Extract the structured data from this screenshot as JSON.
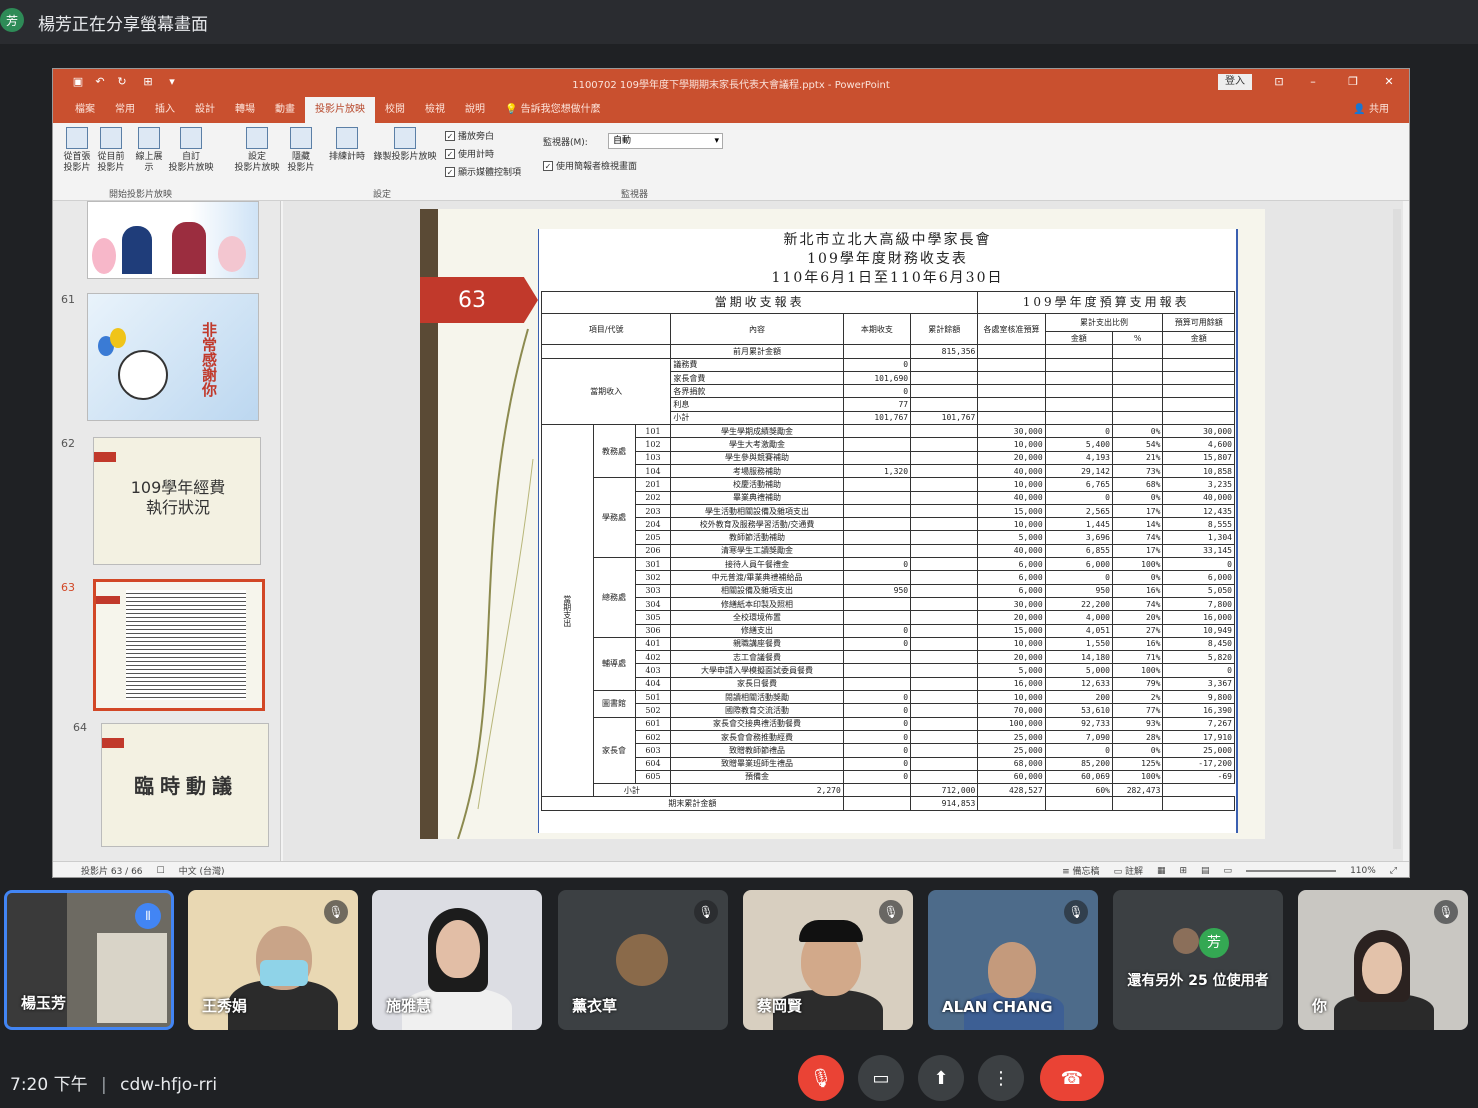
{
  "share_bar": {
    "avatar_initial": "芳",
    "text": "楊芳正在分享螢幕畫面"
  },
  "ppt": {
    "window_title": "1100702 109學年度下學期期末家長代表大會議程.pptx - PowerPoint",
    "login_label": "登入",
    "share_label": "共用",
    "tabs": [
      "檔案",
      "常用",
      "插入",
      "設計",
      "轉場",
      "動畫",
      "投影片放映",
      "校閱",
      "檢視",
      "說明"
    ],
    "tell_me": "告訴我您想做什麼",
    "ribbon_buttons": [
      {
        "label": "從首張\n投影片"
      },
      {
        "label": "從目前\n投影片"
      },
      {
        "label": "線上展\n示"
      },
      {
        "label": "自訂\n投影片放映"
      },
      {
        "label": "設定\n投影片放映"
      },
      {
        "label": "隱藏\n投影片"
      },
      {
        "label": "排練計時"
      },
      {
        "label": "錄製投影片放映"
      }
    ],
    "checkboxes": [
      "播放旁白",
      "使用計時",
      "顯示媒體控制項",
      "使用簡報者檢視畫面"
    ],
    "monitor_label": "監視器(M):",
    "monitor_value": "自動",
    "groups": [
      "開始投影片放映",
      "設定",
      "監視器"
    ],
    "status": {
      "slide_counter": "投影片 63 / 66",
      "language": "中文 (台灣)",
      "notes": "備忘稿",
      "comments": "註解",
      "zoom": "110%"
    }
  },
  "thumbnails": [
    {
      "num": "",
      "kind": "people"
    },
    {
      "num": "61",
      "kind": "thanks",
      "text": "非常感謝你"
    },
    {
      "num": "62",
      "kind": "title",
      "text": "109學年經費\n執行狀況"
    },
    {
      "num": "63",
      "kind": "table"
    },
    {
      "num": "64",
      "kind": "title2",
      "text": "臨時動議"
    }
  ],
  "slide": {
    "number": "63",
    "report_title_1": "新北市立北大高級中學家長會",
    "report_title_2": "109學年度財務收支表",
    "report_title_3": "110年6月1日至110年6月30日",
    "section_left": "當期收支報表",
    "section_right": "109學年度預算支用報表",
    "headers": {
      "item": "項目/代號",
      "content": "內容",
      "current": "本期收支",
      "cum_balance": "累計餘額",
      "approved": "各處室核准預算",
      "cum_ratio": "累計支出比例",
      "amount": "金額",
      "pct": "%",
      "remain": "預算可用餘額",
      "remain_amt": "金額"
    },
    "prev_balance_label": "前月累計金額",
    "prev_balance": "815,356",
    "income_group": "當期收入",
    "income_rows": [
      {
        "content": "議務費",
        "current": "0",
        "cum": ""
      },
      {
        "content": "家長會費",
        "current": "101,690",
        "cum": ""
      },
      {
        "content": "各界捐款",
        "current": "0",
        "cum": ""
      },
      {
        "content": "利息",
        "current": "77",
        "cum": ""
      },
      {
        "content": "小計",
        "current": "101,767",
        "cum": "101,767"
      }
    ],
    "expense_group": "當期支出",
    "expense_depts": [
      {
        "name": "教務處",
        "rows": [
          {
            "code": "101",
            "content": "學生學期成績獎勵金",
            "current": "",
            "budget": "30,000",
            "amt": "0",
            "pct": "0%",
            "remain": "30,000"
          },
          {
            "code": "102",
            "content": "學生大考激勵金",
            "current": "",
            "budget": "10,000",
            "amt": "5,400",
            "pct": "54%",
            "remain": "4,600"
          },
          {
            "code": "103",
            "content": "學生參與競賽補助",
            "current": "",
            "budget": "20,000",
            "amt": "4,193",
            "pct": "21%",
            "remain": "15,807"
          },
          {
            "code": "104",
            "content": "考場服務補助",
            "current": "1,320",
            "budget": "40,000",
            "amt": "29,142",
            "pct": "73%",
            "remain": "10,858"
          }
        ]
      },
      {
        "name": "學務處",
        "rows": [
          {
            "code": "201",
            "content": "校慶活動補助",
            "current": "",
            "budget": "10,000",
            "amt": "6,765",
            "pct": "68%",
            "remain": "3,235"
          },
          {
            "code": "202",
            "content": "畢業典禮補助",
            "current": "",
            "budget": "40,000",
            "amt": "0",
            "pct": "0%",
            "remain": "40,000"
          },
          {
            "code": "203",
            "content": "學生活動相關設備及雜項支出",
            "current": "",
            "budget": "15,000",
            "amt": "2,565",
            "pct": "17%",
            "remain": "12,435"
          },
          {
            "code": "204",
            "content": "校外教育及服務學習活動/交通費",
            "current": "",
            "budget": "10,000",
            "amt": "1,445",
            "pct": "14%",
            "remain": "8,555"
          },
          {
            "code": "205",
            "content": "教師節活動補助",
            "current": "",
            "budget": "5,000",
            "amt": "3,696",
            "pct": "74%",
            "remain": "1,304"
          },
          {
            "code": "206",
            "content": "清寒學生工讀獎勵金",
            "current": "",
            "budget": "40,000",
            "amt": "6,855",
            "pct": "17%",
            "remain": "33,145"
          }
        ]
      },
      {
        "name": "總務處",
        "rows": [
          {
            "code": "301",
            "content": "接待人員午餐禮金",
            "current": "0",
            "budget": "6,000",
            "amt": "6,000",
            "pct": "100%",
            "remain": "0"
          },
          {
            "code": "302",
            "content": "中元普渡/畢業典禮補給品",
            "current": "",
            "budget": "6,000",
            "amt": "0",
            "pct": "0%",
            "remain": "6,000"
          },
          {
            "code": "303",
            "content": "相關設備及雜項支出",
            "current": "950",
            "budget": "6,000",
            "amt": "950",
            "pct": "16%",
            "remain": "5,050"
          },
          {
            "code": "304",
            "content": "修繕紙本印製及照相",
            "current": "",
            "budget": "30,000",
            "amt": "22,200",
            "pct": "74%",
            "remain": "7,800"
          },
          {
            "code": "305",
            "content": "全校環境佈置",
            "current": "",
            "budget": "20,000",
            "amt": "4,000",
            "pct": "20%",
            "remain": "16,000"
          },
          {
            "code": "306",
            "content": "修繕支出",
            "current": "0",
            "budget": "15,000",
            "amt": "4,051",
            "pct": "27%",
            "remain": "10,949"
          }
        ]
      },
      {
        "name": "輔導處",
        "rows": [
          {
            "code": "401",
            "content": "親職講座餐費",
            "current": "0",
            "budget": "10,000",
            "amt": "1,550",
            "pct": "16%",
            "remain": "8,450"
          },
          {
            "code": "402",
            "content": "志工會議餐費",
            "current": "",
            "budget": "20,000",
            "amt": "14,180",
            "pct": "71%",
            "remain": "5,820"
          },
          {
            "code": "403",
            "content": "大學申請入學模擬面試委員餐費",
            "current": "",
            "budget": "5,000",
            "amt": "5,000",
            "pct": "100%",
            "remain": "0"
          },
          {
            "code": "404",
            "content": "家長日餐費",
            "current": "",
            "budget": "16,000",
            "amt": "12,633",
            "pct": "79%",
            "remain": "3,367"
          }
        ]
      },
      {
        "name": "圖書館",
        "rows": [
          {
            "code": "501",
            "content": "閱讀相關活動獎勵",
            "current": "0",
            "budget": "10,000",
            "amt": "200",
            "pct": "2%",
            "remain": "9,800"
          },
          {
            "code": "502",
            "content": "國際教育交流活動",
            "current": "0",
            "budget": "70,000",
            "amt": "53,610",
            "pct": "77%",
            "remain": "16,390"
          }
        ]
      },
      {
        "name": "家長會",
        "rows": [
          {
            "code": "601",
            "content": "家長會交接典禮活動餐費",
            "current": "0",
            "budget": "100,000",
            "amt": "92,733",
            "pct": "93%",
            "remain": "7,267"
          },
          {
            "code": "602",
            "content": "家長會會務推動經費",
            "current": "0",
            "budget": "25,000",
            "amt": "7,090",
            "pct": "28%",
            "remain": "17,910"
          },
          {
            "code": "603",
            "content": "致贈教師節禮品",
            "current": "0",
            "budget": "25,000",
            "amt": "0",
            "pct": "0%",
            "remain": "25,000"
          },
          {
            "code": "604",
            "content": "致贈畢業班師生禮品",
            "current": "0",
            "budget": "68,000",
            "amt": "85,200",
            "pct": "125%",
            "remain": "-17,200"
          },
          {
            "code": "605",
            "content": "預備金",
            "current": "0",
            "budget": "60,000",
            "amt": "60,069",
            "pct": "100%",
            "remain": "-69"
          }
        ]
      }
    ],
    "expense_subtotal_label": "小計",
    "expense_subtotal": "2,270",
    "budget_total": "712,000",
    "amt_total": "428,527",
    "pct_total": "60%",
    "remain_total": "282,473",
    "period_balance_label": "期末累計金額",
    "period_balance": "914,853"
  },
  "participants": [
    {
      "name": "楊玉芳",
      "speaking": true
    },
    {
      "name": "王秀娟",
      "muted": true
    },
    {
      "name": "施雅慧",
      "muted": false
    },
    {
      "name": "薰衣草",
      "muted": true
    },
    {
      "name": "蔡岡賢",
      "muted": true
    },
    {
      "name": "ALAN CHANG",
      "muted": true
    },
    {
      "name": "還有另外 25 位使用者",
      "avatar_initial": "芳"
    },
    {
      "name": "你",
      "muted": true
    }
  ],
  "bottom": {
    "time": "7:20 下午",
    "separator": "|",
    "meeting_code": "cdw-hfjo-rri"
  },
  "colors": {
    "ppt_accent": "#c9502f",
    "slide_red": "#c1392b",
    "hangup": "#ea4335",
    "mic_off": "#ea4335",
    "speaking_border": "#4285f4"
  }
}
